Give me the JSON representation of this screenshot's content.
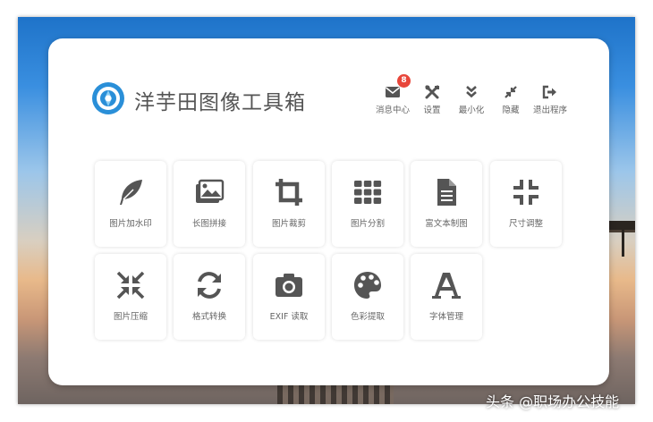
{
  "app": {
    "title": "洋芋田图像工具箱"
  },
  "header": {
    "actions": [
      {
        "label": "消息中心",
        "icon": "envelope-icon",
        "badge": "8"
      },
      {
        "label": "设置",
        "icon": "tools-icon"
      },
      {
        "label": "最小化",
        "icon": "double-chevron-down-icon"
      },
      {
        "label": "隐藏",
        "icon": "compress-arrows-icon"
      },
      {
        "label": "退出程序",
        "icon": "sign-out-icon"
      }
    ]
  },
  "tools": [
    {
      "label": "图片加水印",
      "icon": "feather-icon"
    },
    {
      "label": "长图拼接",
      "icon": "images-icon"
    },
    {
      "label": "图片裁剪",
      "icon": "crop-icon"
    },
    {
      "label": "图片分割",
      "icon": "grid-icon"
    },
    {
      "label": "富文本制图",
      "icon": "document-icon"
    },
    {
      "label": "尺寸调整",
      "icon": "compress-icon"
    },
    {
      "label": "图片压缩",
      "icon": "compress-arrows-icon"
    },
    {
      "label": "格式转换",
      "icon": "sync-icon"
    },
    {
      "label": "EXIF 读取",
      "icon": "camera-icon"
    },
    {
      "label": "色彩提取",
      "icon": "palette-icon"
    },
    {
      "label": "字体管理",
      "icon": "font-icon"
    }
  ],
  "watermark": "头条 @职场办公技能",
  "colors": {
    "icon": "#555555",
    "badge": "#e8463a",
    "logo": "#2a8fd8"
  }
}
